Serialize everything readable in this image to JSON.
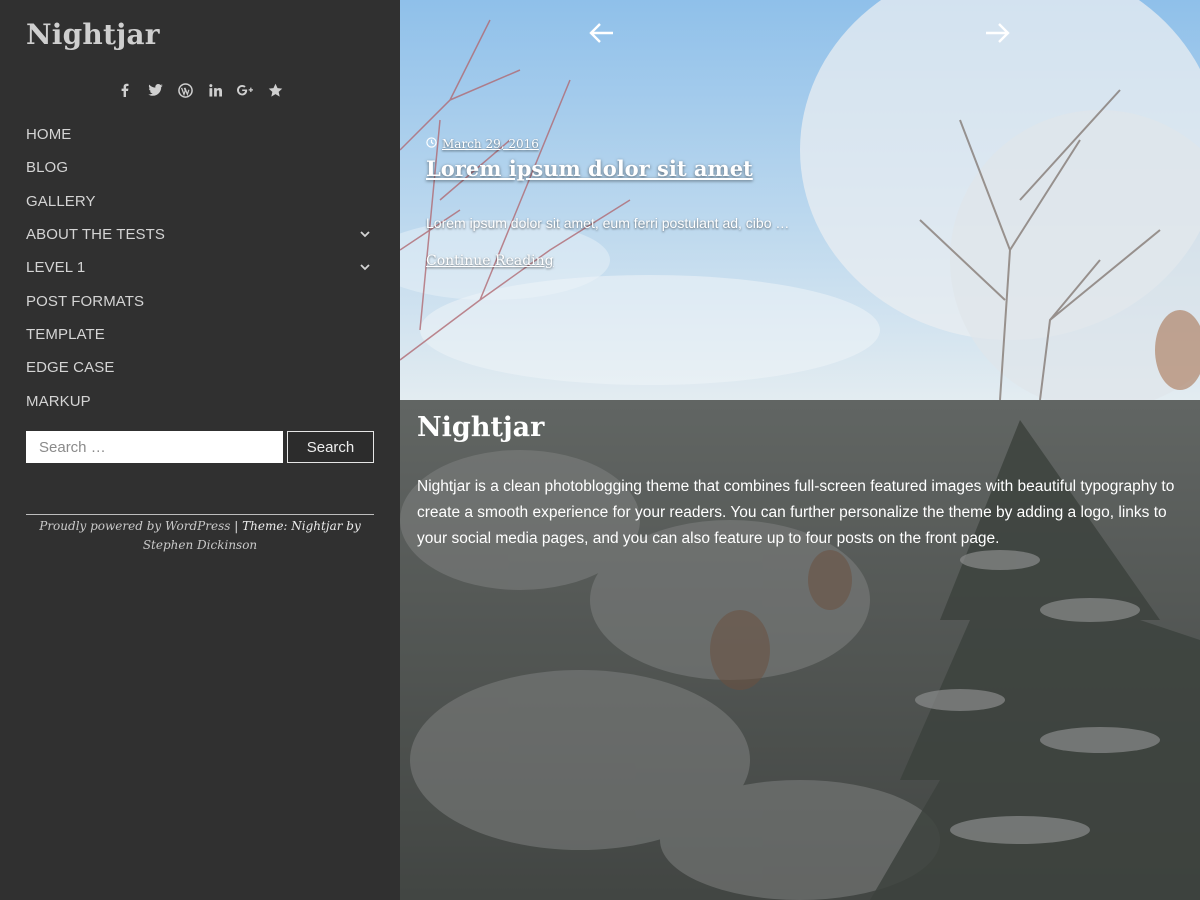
{
  "site": {
    "title": "Nightjar"
  },
  "social": [
    {
      "icon": "facebook-icon",
      "glyph": "f"
    },
    {
      "icon": "twitter-icon",
      "glyph": "🐦"
    },
    {
      "icon": "wordpress-icon",
      "glyph": "W"
    },
    {
      "icon": "linkedin-icon",
      "glyph": "in"
    },
    {
      "icon": "google-plus-icon",
      "glyph": "G+"
    },
    {
      "icon": "star-icon",
      "glyph": "★"
    }
  ],
  "menu": [
    {
      "label": "HOME",
      "has_submenu": false
    },
    {
      "label": "BLOG",
      "has_submenu": false
    },
    {
      "label": "GALLERY",
      "has_submenu": false
    },
    {
      "label": "ABOUT THE TESTS",
      "has_submenu": true
    },
    {
      "label": "LEVEL 1",
      "has_submenu": true
    },
    {
      "label": "POST FORMATS",
      "has_submenu": false
    },
    {
      "label": "TEMPLATE",
      "has_submenu": false
    },
    {
      "label": "EDGE CASE",
      "has_submenu": false
    },
    {
      "label": "MARKUP",
      "has_submenu": false
    }
  ],
  "search": {
    "placeholder": "Search …",
    "value": "",
    "button_label": "Search"
  },
  "footer": {
    "powered": "Proudly powered by WordPress",
    "separator": "|",
    "theme_prefix": "Theme: Nightjar by",
    "author": "Stephen Dickinson"
  },
  "slider": {
    "date": "March 29, 2016",
    "title": "Lorem ipsum dolor sit amet",
    "excerpt": "Lorem ipsum dolor sit amet, eum ferri postulant ad, cibo …",
    "more_label": "Continue Reading"
  },
  "intro": {
    "title": "Nightjar",
    "text": "Nightjar is a clean photoblogging theme that combines full-screen featured images with beautiful typography to create a smooth experience for your readers. You can further personalize the theme by adding a logo, links to your social media pages, and you can also feature up to four posts on the front page."
  },
  "colors": {
    "sidebar_bg": "#303030",
    "sky": "#9fc7ea",
    "overlay": "rgba(60,60,60,0.55)",
    "text_light": "#ffffff"
  }
}
